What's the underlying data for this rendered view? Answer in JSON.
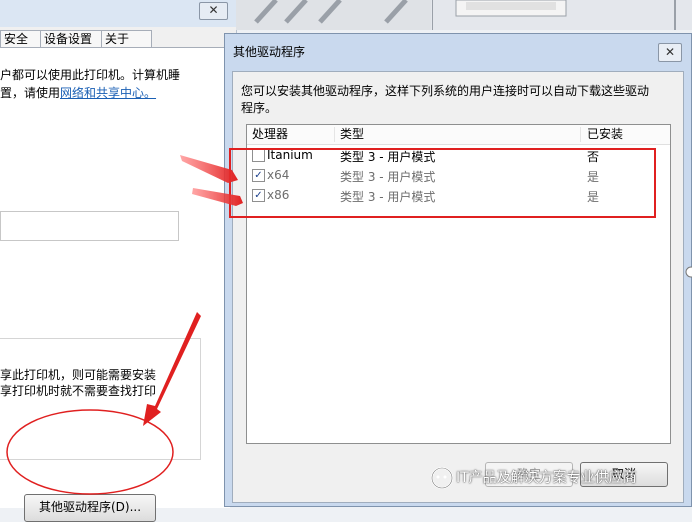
{
  "background_window": {
    "close_glyph": "✕",
    "tabs": [
      "安全",
      "设备设置",
      "关于"
    ],
    "text_line1": "户都可以使用此打印机。计算机睡",
    "text_line2_prefix": "置，请使用",
    "text_line2_link": "网络和共享中心。",
    "share_text1": "享此打印机，则可能需要安装",
    "share_text2": "享打印机时就不需要查找打印",
    "other_drivers_button": "其他驱动程序(D)..."
  },
  "dialog": {
    "title": "其他驱动程序",
    "close_glyph": "✕",
    "description_line1": "您可以安装其他驱动程序，这样下列系统的用户连接时可以自动下载这些驱动",
    "description_line2": "程序。",
    "columns": [
      "处理器",
      "类型",
      "已安装"
    ],
    "rows": [
      {
        "processor": "Itanium",
        "type": "类型 3 - 用户模式",
        "installed": "否",
        "checked": false
      },
      {
        "processor": "x64",
        "type": "类型 3 - 用户模式",
        "installed": "是",
        "checked": true
      },
      {
        "processor": "x86",
        "type": "类型 3 - 用户模式",
        "installed": "是",
        "checked": true
      }
    ],
    "ok_button": "确定",
    "cancel_button": "取消"
  },
  "watermark": {
    "text": "IT产品及解决方案专业供应商"
  },
  "colors": {
    "annotation_red": "#e02020",
    "link_blue": "#1a5fb4",
    "dialog_frame": "#c9d9ee"
  }
}
